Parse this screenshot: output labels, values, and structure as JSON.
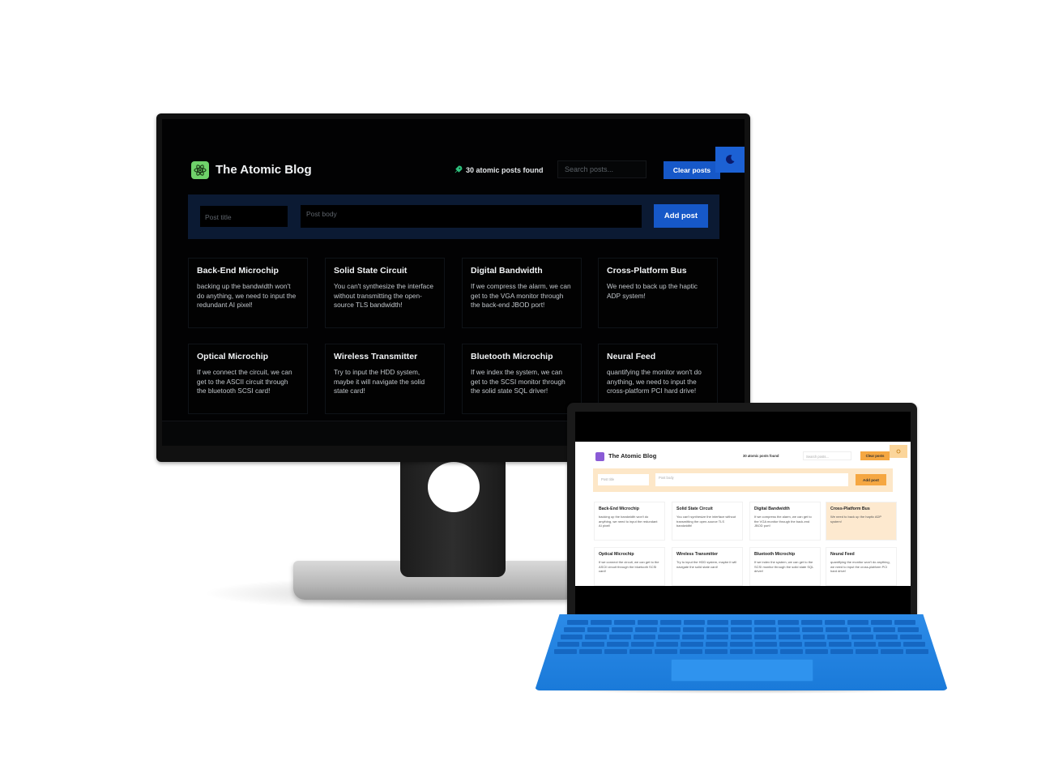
{
  "app": {
    "title": "The Atomic Blog",
    "posts_found": "30 atomic posts found",
    "search_placeholder": "Search posts...",
    "clear_label": "Clear posts",
    "title_placeholder": "Post title",
    "body_placeholder": "Post body",
    "add_label": "Add post"
  },
  "posts": [
    {
      "title": "Back-End Microchip",
      "body": "backing up the bandwidth won't do anything, we need to input the redundant AI pixel!"
    },
    {
      "title": "Solid State Circuit",
      "body": "You can't synthesize the interface without transmitting the open-source TLS bandwidth!"
    },
    {
      "title": "Digital Bandwidth",
      "body": "If we compress the alarm, we can get to the VGA monitor through the back-end JBOD port!"
    },
    {
      "title": "Cross-Platform Bus",
      "body": "We need to back up the haptic ADP system!"
    },
    {
      "title": "Optical Microchip",
      "body": "If we connect the circuit, we can get to the ASCII circuit through the bluetooth SCSI card!"
    },
    {
      "title": "Wireless Transmitter",
      "body": "Try to input the HDD system, maybe it will navigate the solid state card!"
    },
    {
      "title": "Bluetooth Microchip",
      "body": "If we index the system, we can get to the SCSI monitor through the solid state SQL driver!"
    },
    {
      "title": "Neural Feed",
      "body": "quantifying the monitor won't do anything, we need to input the cross-platform PCI hard drive!"
    }
  ],
  "theme": {
    "dark_accent": "#1658c8",
    "dark_logo": "#6fd26a",
    "light_accent": "#f5a742",
    "light_logo": "#8a5bd6"
  }
}
